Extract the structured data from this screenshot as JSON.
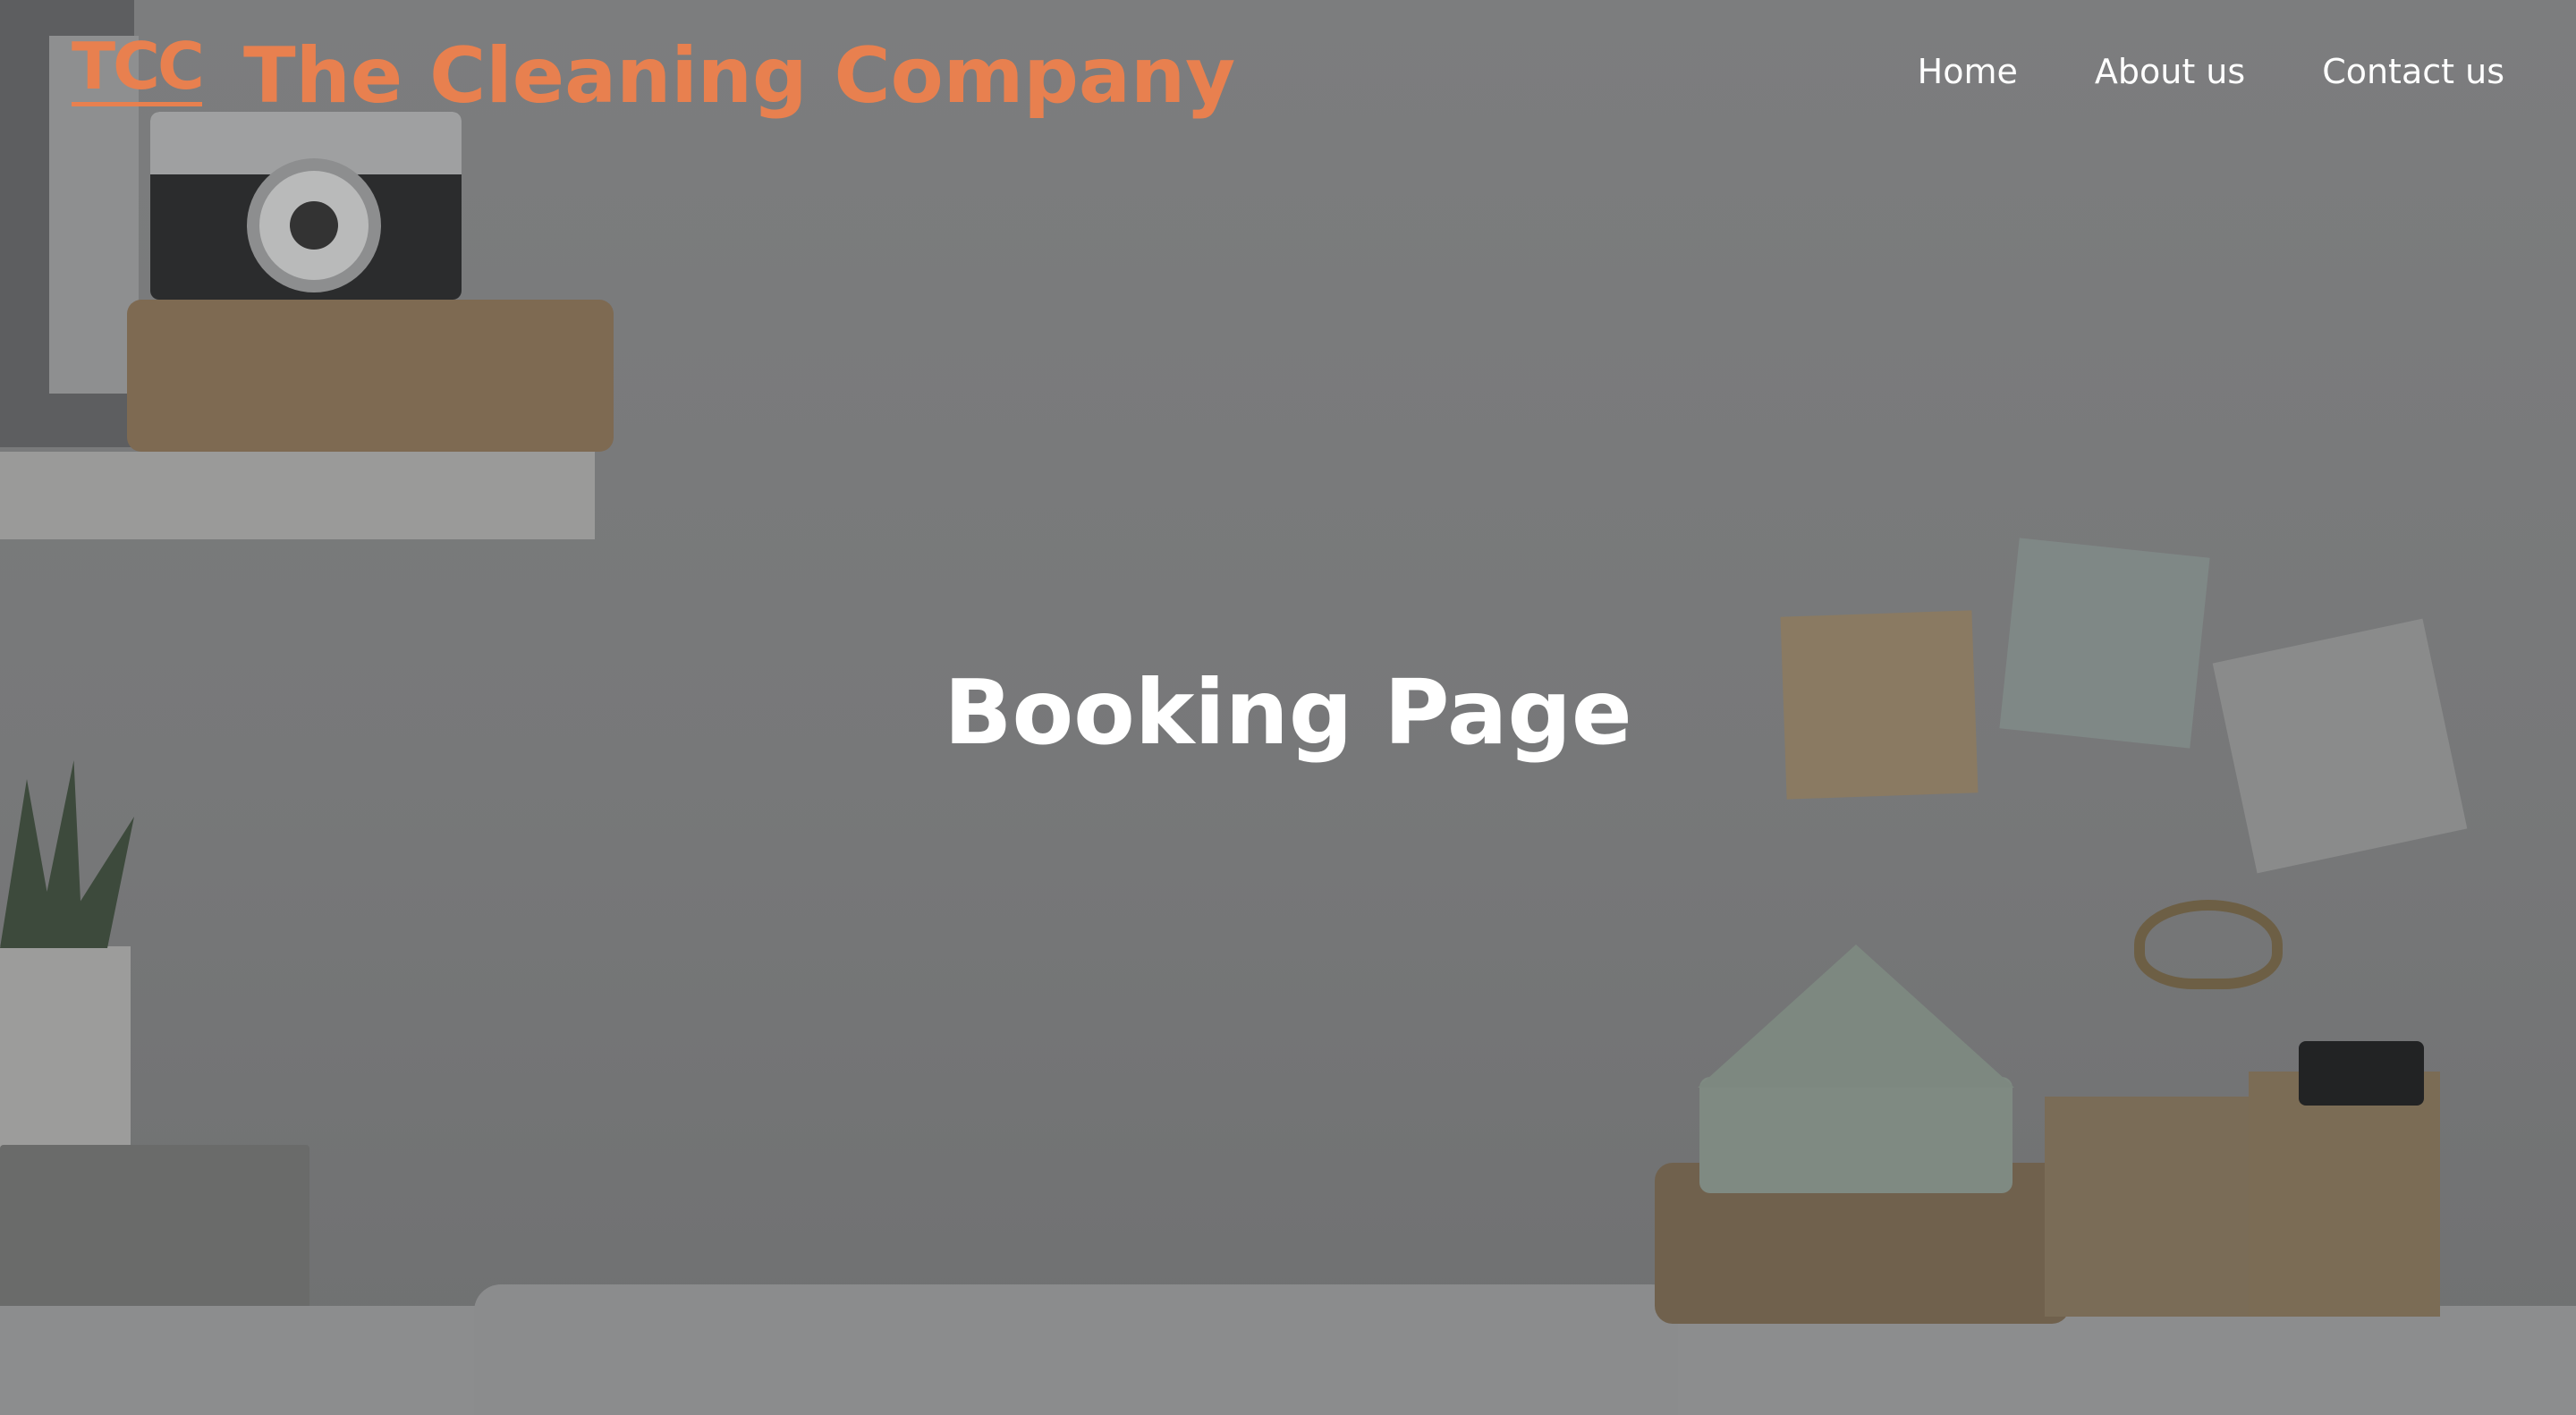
{
  "header": {
    "logo_text": "TCC",
    "brand_name": "The Cleaning Company"
  },
  "nav": {
    "items": [
      {
        "label": "Home"
      },
      {
        "label": "About us"
      },
      {
        "label": "Contact us"
      }
    ]
  },
  "main": {
    "title": "Booking Page"
  },
  "colors": {
    "brand": "#e8804f",
    "text": "#ffffff",
    "background": "#7a7b7c"
  }
}
